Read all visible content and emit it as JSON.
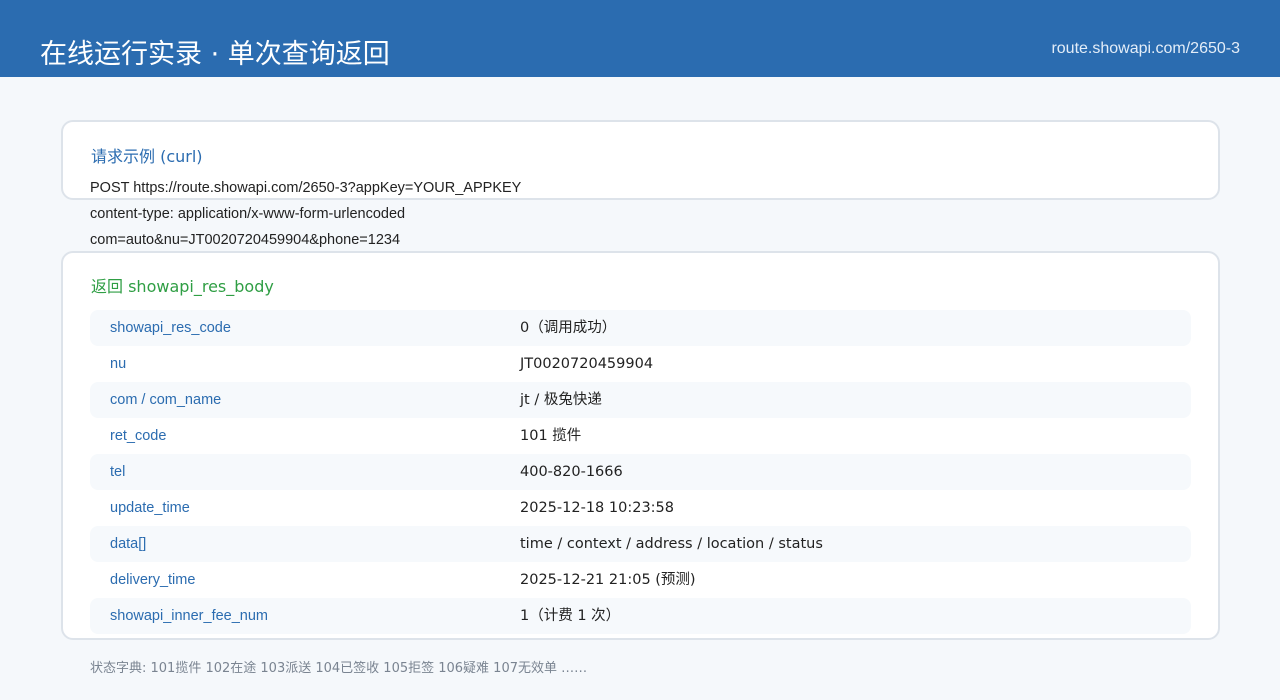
{
  "header": {
    "title": "在线运行实录 · 单次查询返回",
    "url": "route.showapi.com/2650-3"
  },
  "request": {
    "title": "请求示例 (curl)",
    "lines": [
      "POST https://route.showapi.com/2650-3?appKey=YOUR_APPKEY",
      "content-type: application/x-www-form-urlencoded",
      "com=auto&nu=JT0020720459904&phone=1234"
    ]
  },
  "response": {
    "title": "返回 showapi_res_body",
    "rows": [
      {
        "key": "showapi_res_code",
        "value": "0（调用成功）"
      },
      {
        "key": "nu",
        "value": "JT0020720459904"
      },
      {
        "key": "com / com_name",
        "value": "jt / 极兔快递"
      },
      {
        "key": "ret_code",
        "value": "101  揽件"
      },
      {
        "key": "tel",
        "value": "400-820-1666"
      },
      {
        "key": "update_time",
        "value": "2025-12-18 10:23:58"
      },
      {
        "key": "data[]",
        "value": "time / context / address / location / status"
      },
      {
        "key": "delivery_time",
        "value": "2025-12-21 21:05 (预测)"
      },
      {
        "key": "showapi_inner_fee_num",
        "value": "1（计费 1 次）"
      }
    ]
  },
  "footnote": "状态字典: 101揽件 102在途 103派送 104已签收 105拒签 106疑难 107无效单 ……",
  "colors": {
    "header_bg": "#2b6cb0",
    "key_text": "#2b6cb0",
    "response_title": "#2f9e44",
    "card_border": "#dde3ea"
  }
}
